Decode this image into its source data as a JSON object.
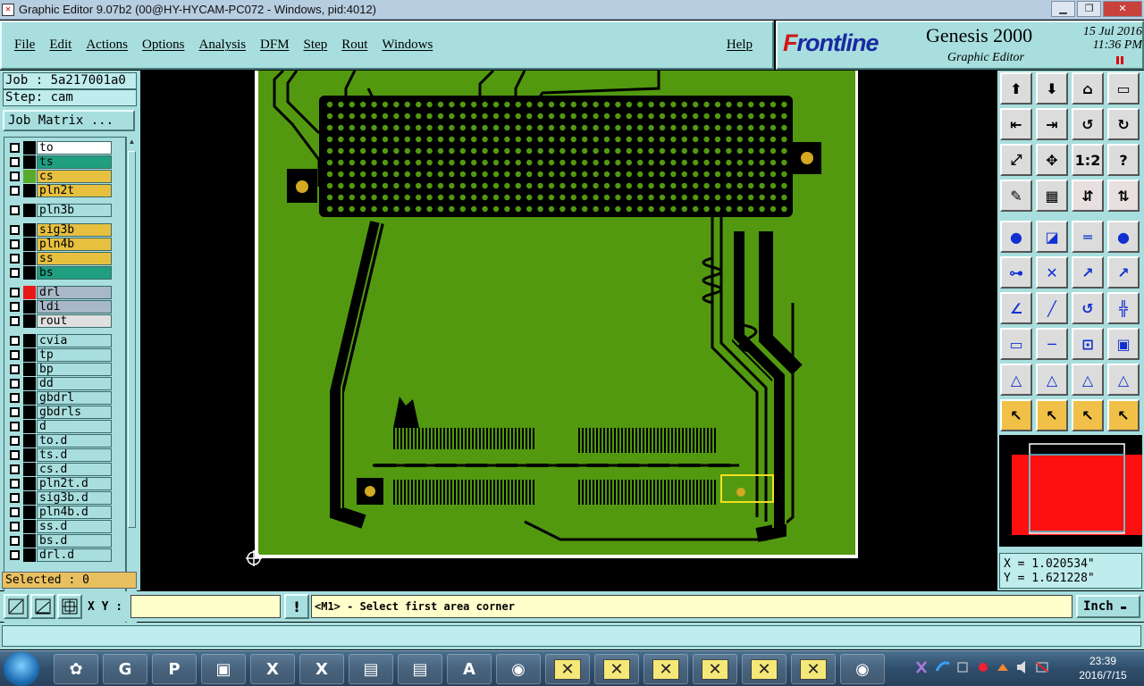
{
  "window": {
    "title": "Graphic Editor 9.07b2 (00@HY-HYCAM-PC072 - Windows, pid:4012)"
  },
  "menu": {
    "items": [
      "File",
      "Edit",
      "Actions",
      "Options",
      "Analysis",
      "DFM",
      "Step",
      "Rout",
      "Windows"
    ],
    "help": "Help"
  },
  "brand": {
    "logo_f": "F",
    "logo_rest": "rontline",
    "product": "Genesis 2000",
    "subtitle": "Graphic Editor",
    "date": "15 Jul 2016",
    "time": "11:36 PM"
  },
  "job": {
    "label": "Job : 5a217001a0",
    "step": "Step: cam",
    "matrix_button": "Job Matrix ..."
  },
  "layers": [
    {
      "name": "to",
      "color": "#ffffff",
      "swatch": "#000000"
    },
    {
      "name": "ts",
      "color": "#1f9f7f",
      "swatch": "#000000"
    },
    {
      "name": "cs",
      "color": "#e8c040",
      "swatch": "#5aaa2a"
    },
    {
      "name": "pln2t",
      "color": "#e8c040",
      "swatch": "#000000"
    },
    {
      "name": "pln3b",
      "color": "#a8dede",
      "swatch": "#000000"
    },
    {
      "name": "sig3b",
      "color": "#e8c040",
      "swatch": "#000000"
    },
    {
      "name": "pln4b",
      "color": "#e8c040",
      "swatch": "#000000"
    },
    {
      "name": "ss",
      "color": "#e8c040",
      "swatch": "#000000"
    },
    {
      "name": "bs",
      "color": "#1f9f7f",
      "swatch": "#000000"
    },
    {
      "name": "drl",
      "color": "#a8b8c8",
      "swatch": "#e81818"
    },
    {
      "name": "ldi",
      "color": "#a8b8c8",
      "swatch": "#000000"
    },
    {
      "name": "rout",
      "color": "#e0e0e0",
      "swatch": "#000000"
    },
    {
      "name": "cvia",
      "color": "#a8dede",
      "swatch": "#000000"
    },
    {
      "name": "tp",
      "color": "#a8dede",
      "swatch": "#000000"
    },
    {
      "name": "bp",
      "color": "#a8dede",
      "swatch": "#000000"
    },
    {
      "name": "dd",
      "color": "#a8dede",
      "swatch": "#000000"
    },
    {
      "name": "gbdrl",
      "color": "#a8dede",
      "swatch": "#000000"
    },
    {
      "name": "gbdrls",
      "color": "#a8dede",
      "swatch": "#000000"
    },
    {
      "name": "d",
      "color": "#a8dede",
      "swatch": "#000000"
    },
    {
      "name": "to.d",
      "color": "#a8dede",
      "swatch": "#000000"
    },
    {
      "name": "ts.d",
      "color": "#a8dede",
      "swatch": "#000000"
    },
    {
      "name": "cs.d",
      "color": "#a8dede",
      "swatch": "#000000"
    },
    {
      "name": "pln2t.d",
      "color": "#a8dede",
      "swatch": "#000000"
    },
    {
      "name": "sig3b.d",
      "color": "#a8dede",
      "swatch": "#000000"
    },
    {
      "name": "pln4b.d",
      "color": "#a8dede",
      "swatch": "#000000"
    },
    {
      "name": "ss.d",
      "color": "#a8dede",
      "swatch": "#000000"
    },
    {
      "name": "bs.d",
      "color": "#a8dede",
      "swatch": "#000000"
    },
    {
      "name": "drl.d",
      "color": "#a8dede",
      "swatch": "#000000"
    }
  ],
  "selected": "Selected : 0",
  "coords": {
    "x": "X = 1.020534\"",
    "y": "Y = 1.621228\""
  },
  "command": {
    "xy_label": "X Y :",
    "xy_value": "",
    "message": "<M1> - Select first area corner",
    "unit": "Inch"
  },
  "taskbar": {
    "time": "23:39",
    "date": "2016/7/15"
  },
  "colors": {
    "board": "#52990f",
    "panel": "#a8dede",
    "pad": "#d4a820"
  }
}
